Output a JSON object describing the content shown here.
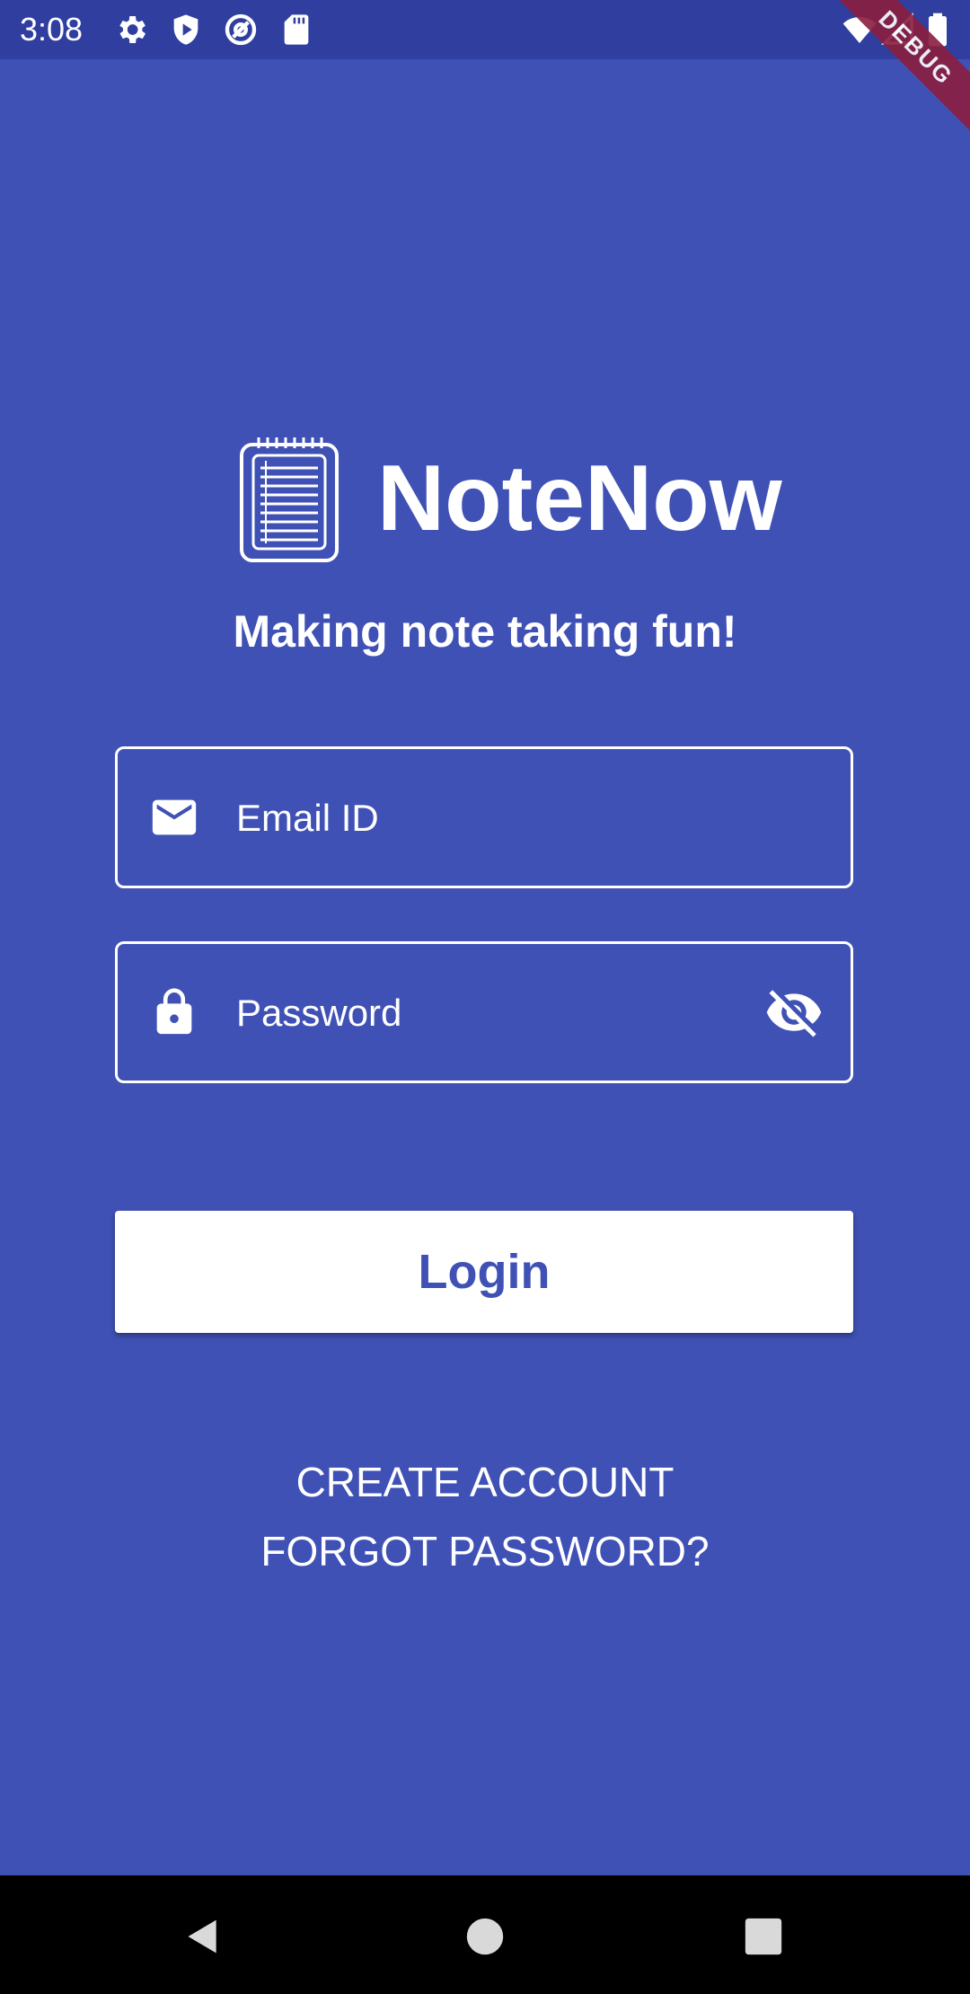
{
  "status_bar": {
    "time": "3:08",
    "icons": [
      "gear-icon",
      "shield-play-icon",
      "at-sign-icon",
      "sd-card-icon",
      "wifi-icon",
      "signal-icon",
      "battery-icon"
    ],
    "debug_label": "DEBUG"
  },
  "app": {
    "title": "NoteNow",
    "tagline": "Making note taking fun!",
    "logo_icon": "notepad-icon"
  },
  "form": {
    "email": {
      "placeholder": "Email ID",
      "value": "",
      "icon": "mail-icon"
    },
    "password": {
      "placeholder": "Password",
      "value": "",
      "icon": "lock-icon",
      "toggle_icon": "eye-off-icon"
    }
  },
  "actions": {
    "login_label": "Login",
    "create_account_label": "CREATE ACCOUNT",
    "forgot_password_label": "FORGOT PASSWORD?"
  },
  "nav": {
    "icons": [
      "back-icon",
      "home-icon",
      "recents-icon"
    ]
  },
  "colors": {
    "background": "#3f51b5",
    "status_bar": "#303f9f",
    "button_bg": "#ffffff",
    "button_text": "#3f51b5",
    "debug_ribbon": "#8b1e3f"
  }
}
